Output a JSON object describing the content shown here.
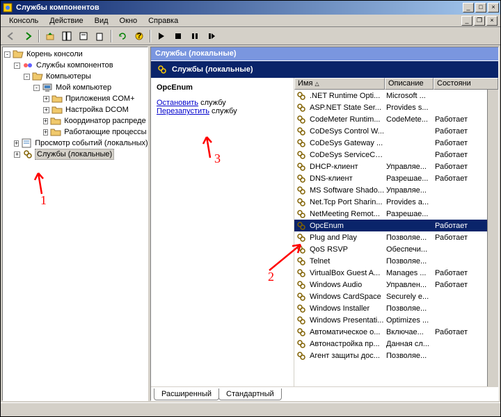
{
  "window": {
    "title": "Службы компонентов"
  },
  "menu": {
    "console": "Консоль",
    "action": "Действие",
    "view": "Вид",
    "window": "Окно",
    "help": "Справка"
  },
  "tree": {
    "root": "Корень консоли",
    "comp_services": "Службы компонентов",
    "computers": "Компьютеры",
    "my_computer": "Мой компьютер",
    "com_apps": "Приложения COM+",
    "dcom": "Настройка DCOM",
    "coord": "Координатор распреде",
    "running": "Работающие процессы",
    "event_viewer": "Просмотр событий (локальных)",
    "services_local": "Службы (локальные)"
  },
  "pane": {
    "header1": "Службы (локальные)",
    "header2": "Службы (локальные)"
  },
  "info": {
    "selected": "OpcEnum",
    "stop": "Остановить",
    "stop_suffix": " службу",
    "restart": "Перезапустить",
    "restart_suffix": " службу"
  },
  "columns": {
    "name": "Имя",
    "desc": "Описание",
    "state": "Состояни"
  },
  "col_widths": {
    "name": 130,
    "desc": 70,
    "state": 60
  },
  "services": [
    {
      "name": ".NET Runtime Opti...",
      "desc": "Microsoft ...",
      "state": ""
    },
    {
      "name": "ASP.NET State Ser...",
      "desc": "Provides s...",
      "state": ""
    },
    {
      "name": "CodeMeter Runtim...",
      "desc": "CodeMete...",
      "state": "Работает"
    },
    {
      "name": "CoDeSys Control W...",
      "desc": "",
      "state": "Работает"
    },
    {
      "name": "CoDeSys Gateway ...",
      "desc": "",
      "state": "Работает"
    },
    {
      "name": "CoDeSys ServiceCo...",
      "desc": "",
      "state": "Работает"
    },
    {
      "name": "DHCP-клиент",
      "desc": "Управляе...",
      "state": "Работает"
    },
    {
      "name": "DNS-клиент",
      "desc": "Разрешае...",
      "state": "Работает"
    },
    {
      "name": "MS Software Shado...",
      "desc": "Управляе...",
      "state": ""
    },
    {
      "name": "Net.Tcp Port Sharin...",
      "desc": "Provides a...",
      "state": ""
    },
    {
      "name": "NetMeeting Remot...",
      "desc": "Разрешае...",
      "state": ""
    },
    {
      "name": "OpcEnum",
      "desc": "",
      "state": "Работает",
      "selected": true
    },
    {
      "name": "Plug and Play",
      "desc": "Позволяе...",
      "state": "Работает"
    },
    {
      "name": "QoS RSVP",
      "desc": "Обеспечи...",
      "state": ""
    },
    {
      "name": "Telnet",
      "desc": "Позволяе...",
      "state": ""
    },
    {
      "name": "VirtualBox Guest A...",
      "desc": "Manages ...",
      "state": "Работает"
    },
    {
      "name": "Windows Audio",
      "desc": "Управлен...",
      "state": "Работает"
    },
    {
      "name": "Windows CardSpace",
      "desc": "Securely e...",
      "state": ""
    },
    {
      "name": "Windows Installer",
      "desc": "Позволяе...",
      "state": ""
    },
    {
      "name": "Windows Presentati...",
      "desc": "Optimizes ...",
      "state": ""
    },
    {
      "name": "Автоматическое о...",
      "desc": "Включае...",
      "state": "Работает"
    },
    {
      "name": "Автонастройка пр...",
      "desc": "Данная сл...",
      "state": ""
    },
    {
      "name": "Агент защиты дос...",
      "desc": "Позволяе...",
      "state": ""
    }
  ],
  "tabs": {
    "extended": "Расширенный",
    "standard": "Стандартный"
  },
  "annotations": {
    "a1": "1",
    "a2": "2",
    "a3": "3"
  }
}
